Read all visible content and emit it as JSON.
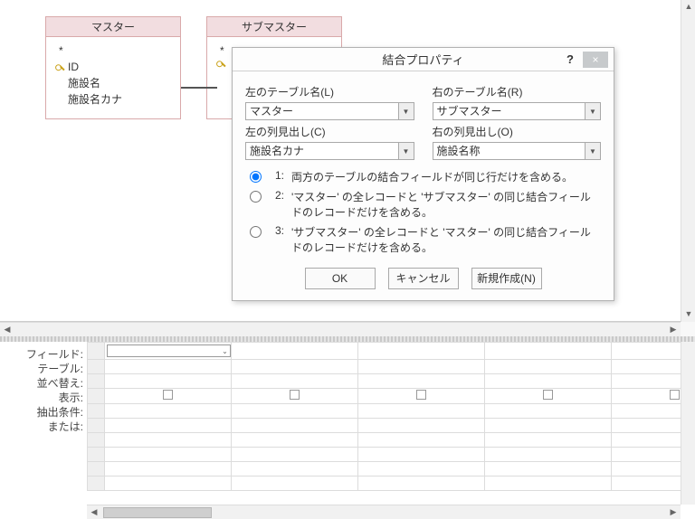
{
  "entities": [
    {
      "title": "マスター",
      "star": "*",
      "fields": [
        {
          "key": true,
          "name": "ID"
        },
        {
          "key": false,
          "name": "施設名"
        },
        {
          "key": false,
          "name": "施設名カナ"
        }
      ]
    },
    {
      "title": "サブマスター",
      "star": "*",
      "fields": [
        {
          "key": true,
          "name": ""
        }
      ]
    }
  ],
  "dialog": {
    "title": "結合プロパティ",
    "help": "?",
    "close": "×",
    "left_table_label": "左のテーブル名(L)",
    "left_table_value": "マスター",
    "right_table_label": "右のテーブル名(R)",
    "right_table_value": "サブマスター",
    "left_col_label": "左の列見出し(C)",
    "left_col_value": "施設名カナ",
    "right_col_label": "右の列見出し(O)",
    "right_col_value": "施設名称",
    "radios": [
      {
        "num": "1:",
        "desc": "両方のテーブルの結合フィールドが同じ行だけを含める。",
        "checked": true
      },
      {
        "num": "2:",
        "desc": "'マスター' の全レコードと 'サブマスター' の同じ結合フィールドのレコードだけを含める。",
        "checked": false
      },
      {
        "num": "3:",
        "desc": "'サブマスター' の全レコードと 'マスター' の同じ結合フィールドのレコードだけを含める。",
        "checked": false
      }
    ],
    "ok": "OK",
    "cancel": "キャンセル",
    "new": "新規作成(N)"
  },
  "grid": {
    "labels": {
      "field": "フィールド:",
      "table": "テーブル:",
      "sort": "並べ替え:",
      "show": "表示:",
      "criteria": "抽出条件:",
      "or": "または:"
    }
  }
}
